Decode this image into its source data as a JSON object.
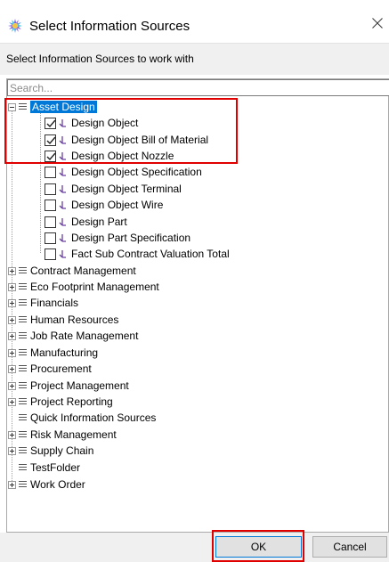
{
  "dialog": {
    "title": "Select Information Sources",
    "instruction": "Select Information Sources to work with"
  },
  "search": {
    "placeholder": "Search...",
    "value": ""
  },
  "tree": {
    "root_expanded": {
      "label": "Asset Design",
      "children": [
        {
          "label": "Design Object",
          "checked": true
        },
        {
          "label": "Design Object Bill of Material",
          "checked": true
        },
        {
          "label": "Design Object Nozzle",
          "checked": true
        },
        {
          "label": "Design Object Specification",
          "checked": false
        },
        {
          "label": "Design Object Terminal",
          "checked": false
        },
        {
          "label": "Design Object Wire",
          "checked": false
        },
        {
          "label": "Design Part",
          "checked": false
        },
        {
          "label": "Design Part Specification",
          "checked": false
        },
        {
          "label": "Fact Sub Contract Valuation Total",
          "checked": false
        }
      ]
    },
    "folders": [
      {
        "label": "Contract Management",
        "expandable": true
      },
      {
        "label": "Eco Footprint Management",
        "expandable": true
      },
      {
        "label": "Financials",
        "expandable": true
      },
      {
        "label": "Human Resources",
        "expandable": true
      },
      {
        "label": "Job Rate Management",
        "expandable": true
      },
      {
        "label": "Manufacturing",
        "expandable": true
      },
      {
        "label": "Procurement",
        "expandable": true
      },
      {
        "label": "Project Management",
        "expandable": true
      },
      {
        "label": "Project Reporting",
        "expandable": true
      },
      {
        "label": "Quick Information Sources",
        "expandable": false
      },
      {
        "label": "Risk Management",
        "expandable": true
      },
      {
        "label": "Supply Chain",
        "expandable": true
      },
      {
        "label": "TestFolder",
        "expandable": false
      },
      {
        "label": "Work Order",
        "expandable": true
      }
    ]
  },
  "buttons": {
    "ok": "OK",
    "cancel": "Cancel"
  },
  "colors": {
    "selection": "#0078d7",
    "highlight": "#e00000",
    "source_icon": "#6a3fa0"
  }
}
